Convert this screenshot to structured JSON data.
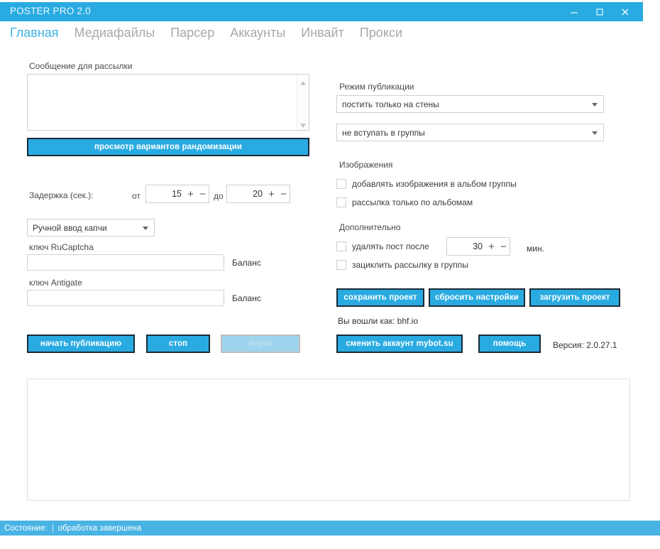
{
  "window": {
    "title": "POSTER PRO 2.0",
    "controls": [
      {
        "name": "minimize",
        "glyph": "minimize-icon"
      },
      {
        "name": "maximize",
        "glyph": "maximize-icon"
      },
      {
        "name": "close",
        "glyph": "close-icon"
      }
    ],
    "accent_color": "#29ABE2",
    "titlebar_color": "#29ABE2",
    "statusbar_color": "#49b3e4"
  },
  "menu": {
    "items": [
      {
        "label": "Главная",
        "active": true
      },
      {
        "label": "Медиафайлы",
        "active": false
      },
      {
        "label": "Парсер",
        "active": false
      },
      {
        "label": "Аккаунты",
        "active": false
      },
      {
        "label": "Инвайт",
        "active": false
      },
      {
        "label": "Прокси",
        "active": false
      }
    ]
  },
  "left": {
    "message_label": "Сообщение для рассылки",
    "message_value": "",
    "message_placeholder": "",
    "randomize_button": "просмотр вариантов рандомизации",
    "delay_label": "Задержка  (сек.):",
    "delay_from_label": "от",
    "delay_from_value": "15",
    "delay_to_label": "до",
    "delay_to_value": "20",
    "captcha_mode": "Ручной ввод капчи",
    "rucaptcha_label": "ключ RuCaptcha",
    "rucaptcha_value": "",
    "rucaptcha_balance": "Баланс",
    "antigate_label": "ключ Antigate",
    "antigate_value": "",
    "antigate_balance": "Баланс",
    "start_button": "начать публикацию",
    "stop_button": "стоп",
    "pause_button": "пауза"
  },
  "right": {
    "mode_label": "Режим публикации",
    "mode_value": "постить только на стены",
    "groups_value": "не вступать в группы",
    "images_label": "Изображения",
    "images_checkbox_1": "добавлять изображения в альбом группы",
    "images_checkbox_2": "рассылка только по альбомам",
    "extra_label": "Дополнительно",
    "delete_post_label": "удалять пост после",
    "delete_post_value": "30",
    "delete_post_unit": "мин.",
    "loop_checkbox": "зациклить рассылку в группы",
    "save_project_button": "сохранить проект",
    "reset_settings_button": "сбросить настройки",
    "load_project_button": "загрузить проект",
    "logged_in_as": "Вы вошли как: bhf.io",
    "change_account_button": "сменить аккаунт mybot.su",
    "help_button": "помощь",
    "version": "Версия: 2.0.27.1"
  },
  "log": {
    "content": ""
  },
  "statusbar": {
    "label": "Состояние:",
    "value": "обработка завершена"
  }
}
